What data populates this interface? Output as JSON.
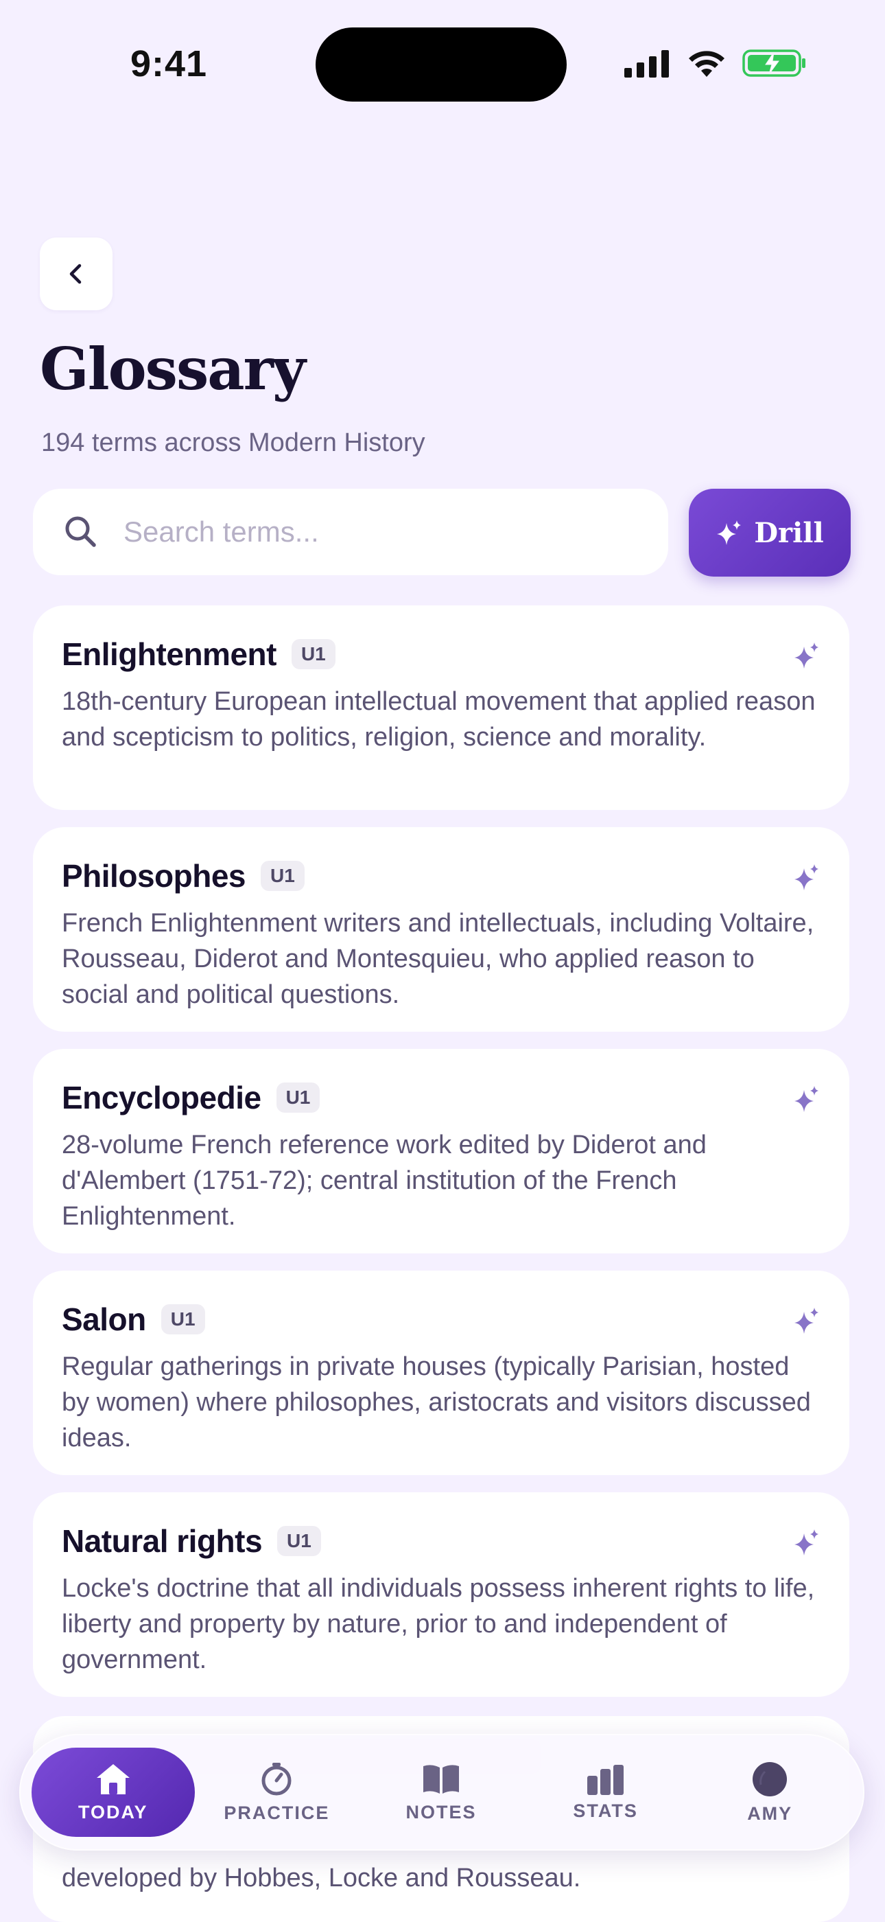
{
  "status_bar": {
    "time": "9:41"
  },
  "header": {
    "title": "Glossary",
    "subtitle": "194 terms across Modern History"
  },
  "search": {
    "placeholder": "Search terms..."
  },
  "drill_button": {
    "label": "Drill"
  },
  "terms": [
    {
      "term": "Enlightenment",
      "unit": "U1",
      "definition": "18th-century European intellectual movement that applied reason and scepticism to politics, religion, science and morality."
    },
    {
      "term": "Philosophes",
      "unit": "U1",
      "definition": "French Enlightenment writers and intellectuals, including Voltaire, Rousseau, Diderot and Montesquieu, who applied reason to social and political questions."
    },
    {
      "term": "Encyclopedie",
      "unit": "U1",
      "definition": "28-volume French reference work edited by Diderot and d'Alembert (1751-72); central institution of the French Enlightenment."
    },
    {
      "term": "Salon",
      "unit": "U1",
      "definition": "Regular gatherings in private houses (typically Parisian, hosted by women) where philosophes, aristocrats and visitors discussed ideas."
    },
    {
      "term": "Natural rights",
      "unit": "U1",
      "definition": "Locke's doctrine that all individuals possess inherent rights to life, liberty and property by nature, prior to and independent of government."
    }
  ],
  "partial_card": {
    "visible_text": "developed by Hobbes, Locke and Rousseau."
  },
  "tab_bar": {
    "tabs": [
      {
        "label": "TODAY",
        "icon": "home-icon",
        "active": true
      },
      {
        "label": "PRACTICE",
        "icon": "timer-icon",
        "active": false
      },
      {
        "label": "NOTES",
        "icon": "book-icon",
        "active": false
      },
      {
        "label": "STATS",
        "icon": "bar-chart-icon",
        "active": false
      },
      {
        "label": "AMY",
        "icon": "avatar-icon",
        "active": false
      }
    ]
  },
  "colors": {
    "accent": "#6a3bc8",
    "background": "#f5f0ff",
    "battery": "#34c759"
  }
}
